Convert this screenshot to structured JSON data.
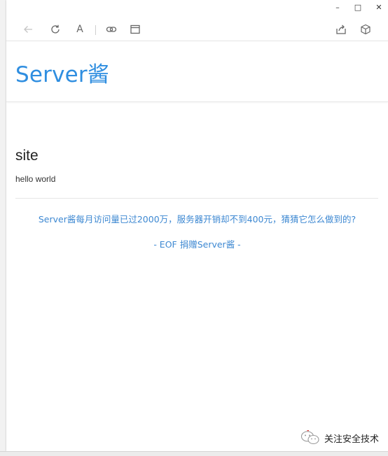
{
  "window_controls": {
    "minimize": "–",
    "maximize": "□",
    "close": "✕"
  },
  "toolbar": {
    "back_icon": "back-arrow-icon",
    "refresh_icon": "refresh-icon",
    "font_label": "A",
    "link_icon": "link-icon",
    "window_icon": "window-icon",
    "share_icon": "share-icon",
    "box_icon": "cube-icon"
  },
  "site": {
    "title": "Server酱",
    "title_color": "#2f8ee0"
  },
  "post": {
    "title": "site",
    "body": "hello world"
  },
  "footer": {
    "promo_text": "Server酱每月访问量已过2000万，服务器开销却不到400元，猜猜它怎么做到的?",
    "eof_text": "- EOF 捐赠Server酱 -",
    "link_color": "#3d88d2"
  },
  "watermark": {
    "text": "关注安全技术",
    "icon": "wechat-icon"
  }
}
